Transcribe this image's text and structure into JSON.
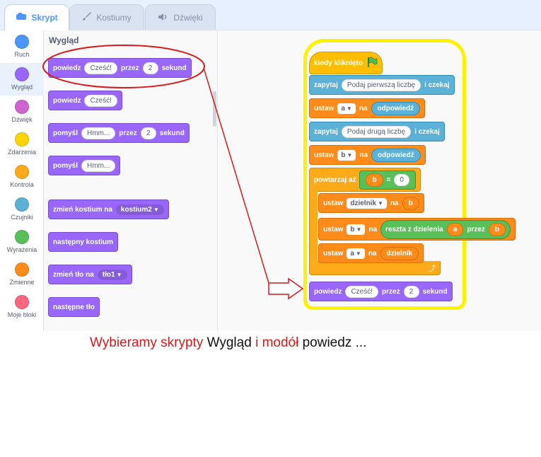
{
  "tabs": [
    {
      "label": "Skrypt",
      "icon": "code-icon"
    },
    {
      "label": "Kostiumy",
      "icon": "brush-icon"
    },
    {
      "label": "Dźwięki",
      "icon": "speaker-icon"
    }
  ],
  "categories": [
    {
      "label": "Ruch",
      "color": "#4c97ff"
    },
    {
      "label": "Wygląd",
      "color": "#9966ff"
    },
    {
      "label": "Dźwięk",
      "color": "#cf63cf"
    },
    {
      "label": "Zdarzenia",
      "color": "#ffd500"
    },
    {
      "label": "Kontrola",
      "color": "#ffab19"
    },
    {
      "label": "Czujniki",
      "color": "#5cb1d6"
    },
    {
      "label": "Wyrażenia",
      "color": "#59c059"
    },
    {
      "label": "Zmienne",
      "color": "#ff8c1a"
    },
    {
      "label": "Moje bloki",
      "color": "#ff6680"
    }
  ],
  "selected_category": "Wygląd",
  "palette": {
    "title": "Wygląd",
    "say_for": {
      "label": "powiedz",
      "text": "Cześć!",
      "mid": "przez",
      "secs": "2",
      "unit": "sekund"
    },
    "say": {
      "label": "powiedz",
      "text": "Cześć!"
    },
    "think_for": {
      "label": "pomyśl",
      "text": "Hmm...",
      "mid": "przez",
      "secs": "2",
      "unit": "sekund"
    },
    "think": {
      "label": "pomyśl",
      "text": "Hmm..."
    },
    "switch_costume": {
      "label": "zmień kostium na",
      "value": "kostium2"
    },
    "next_costume": {
      "label": "następny kostium"
    },
    "switch_backdrop": {
      "label": "zmień tło na",
      "value": "tło1"
    },
    "next_backdrop": {
      "label": "następne tło"
    }
  },
  "script": {
    "hat": {
      "label": "kiedy kliknięto"
    },
    "ask1": {
      "label": "zapytaj",
      "text": "Podaj pierwszą liczbę",
      "suffix": "i czekaj"
    },
    "set_a": {
      "label": "ustaw",
      "var": "a",
      "to": "na",
      "value": "odpowiedź"
    },
    "ask2": {
      "label": "zapytaj",
      "text": "Podaj drugą liczbę",
      "suffix": "i czekaj"
    },
    "set_b": {
      "label": "ustaw",
      "var": "b",
      "to": "na",
      "value": "odpowiedź"
    },
    "repeat": {
      "label": "powtarzaj aż",
      "left": "b",
      "op": "=",
      "right": "0"
    },
    "set_dz": {
      "label": "ustaw",
      "var": "dzielnik",
      "to": "na",
      "value": "b"
    },
    "set_b2": {
      "label": "ustaw",
      "var": "b",
      "to": "na",
      "op_label": "reszta z dzielenia",
      "a": "a",
      "mid": "przez",
      "b": "b"
    },
    "set_a2": {
      "label": "ustaw",
      "var": "a",
      "to": "na",
      "value": "dzielnik"
    },
    "say_for": {
      "label": "powiedz",
      "text": "Cześć!",
      "mid": "przez",
      "secs": "2",
      "unit": "sekund"
    }
  },
  "caption": {
    "part1": "Wybieramy skrypty",
    "part2": "Wygląd",
    "part3": "i modół",
    "part4": "powiedz ..."
  },
  "colors": {
    "annotation": "#d41c1c",
    "highlight": "#fff200"
  }
}
